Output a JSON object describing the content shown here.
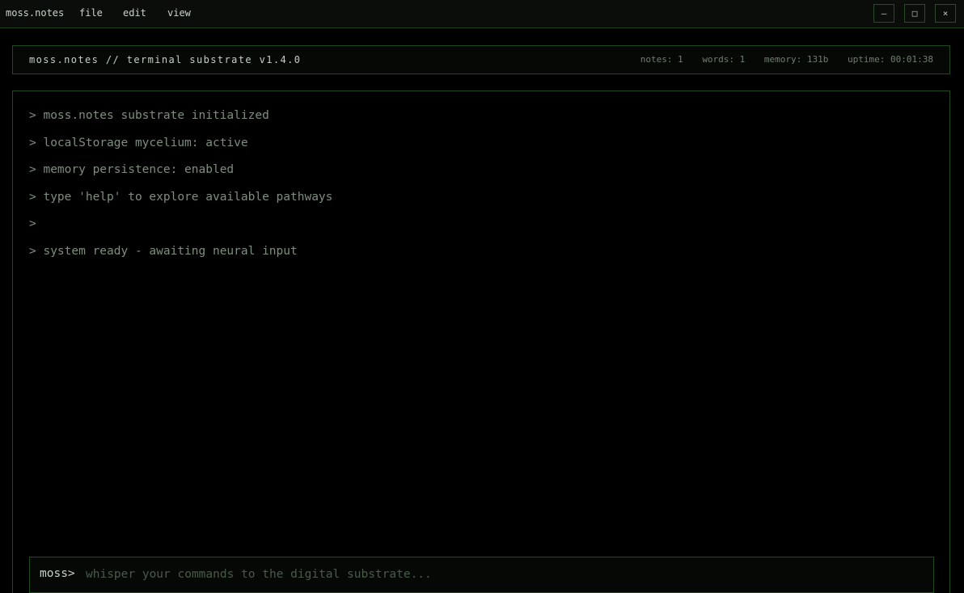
{
  "titlebar": {
    "app_name": "moss.notes",
    "menus": [
      "file",
      "edit",
      "view"
    ],
    "window_controls": {
      "minimize": "–",
      "maximize": "□",
      "close": "×"
    }
  },
  "status": {
    "title": "moss.notes // terminal substrate v1.4.0",
    "notes": "notes: 1",
    "words": "words: 1",
    "memory": "memory: 131b",
    "uptime": "uptime: 00:01:38"
  },
  "terminal": {
    "lines": [
      "> moss.notes substrate initialized",
      "> localStorage mycelium: active",
      "> memory persistence: enabled",
      "> type 'help' to explore available pathways",
      ">",
      "> system ready - awaiting neural input"
    ],
    "prompt": "moss>",
    "input_value": "",
    "input_placeholder": "whisper your commands to the digital substrate..."
  },
  "colors": {
    "background": "#000000",
    "border": "#1f4a1f",
    "text": "#7e8e7e",
    "bright_text": "#c8d4c8"
  }
}
